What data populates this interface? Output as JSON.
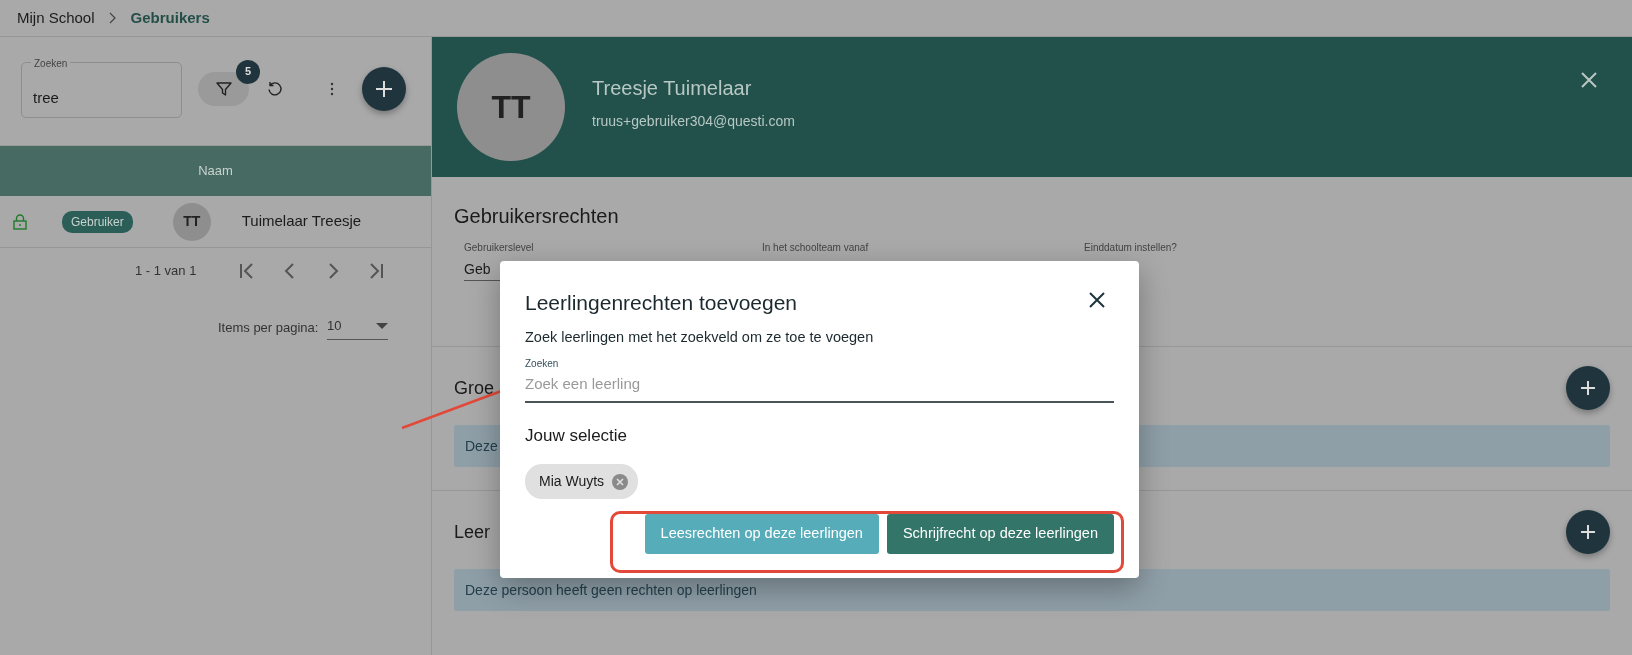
{
  "breadcrumb": [
    {
      "label": "Mijn School",
      "current": false
    },
    {
      "label": "Gebruikers",
      "current": true
    }
  ],
  "users_panel": {
    "search": {
      "label": "Zoeken",
      "value": "tree"
    },
    "filter_count": "5",
    "table": {
      "columns": [
        "Naam"
      ],
      "rows": [
        {
          "role": "Gebruiker",
          "initials": "TT",
          "name": "Tuimelaar Treesje"
        }
      ]
    },
    "pagination": {
      "range": "1 - 1 van 1"
    },
    "items_per_page": {
      "label": "Items per pagina:",
      "value": "10"
    }
  },
  "profile": {
    "initials": "TT",
    "name": "Treesje Tuimelaar",
    "email": "truus+gebruiker304@questi.com"
  },
  "rights": {
    "title": "Gebruikersrechten",
    "fields": [
      {
        "label": "Gebruikerslevel",
        "value": "Geb"
      },
      {
        "label": "In het schoolteam vanaf"
      },
      {
        "label": "Einddatum instellen?"
      }
    ]
  },
  "sections": [
    {
      "title": "Groe",
      "notice": "Deze"
    },
    {
      "title": "Leer",
      "notice": "Deze persoon heeft geen rechten op leerlingen"
    }
  ],
  "modal": {
    "title": "Leerlingenrechten toevoegen",
    "subtitle": "Zoek leerlingen met het zoekveld om ze toe te voegen",
    "search": {
      "label": "Zoeken",
      "placeholder": "Zoek een leerling"
    },
    "selection_title": "Jouw selectie",
    "chips": [
      {
        "label": "Mia Wuyts"
      }
    ],
    "buttons": [
      {
        "label": "Leesrechten op deze leerlingen",
        "kind": "secondary"
      },
      {
        "label": "Schrijfrecht op deze leerlingen",
        "kind": "primary"
      }
    ]
  }
}
